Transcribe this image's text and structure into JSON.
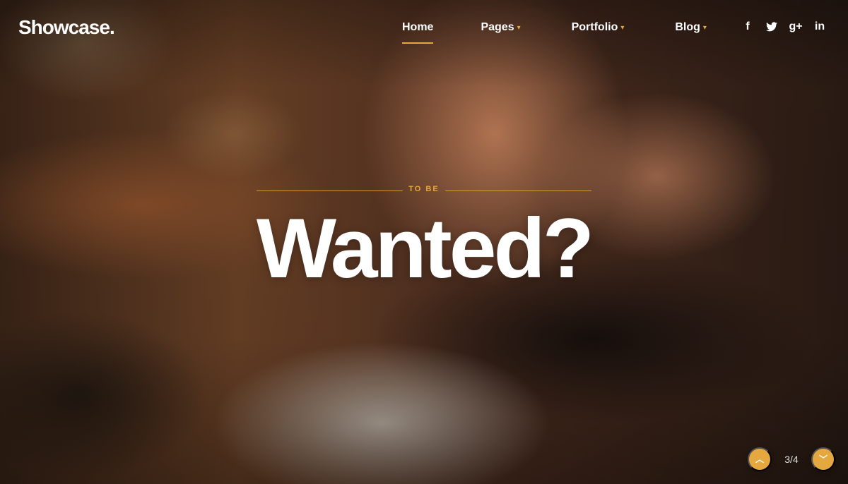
{
  "brand": {
    "name": "Showcase."
  },
  "nav": {
    "items": [
      {
        "label": "Home"
      },
      {
        "label": "Pages"
      },
      {
        "label": "Portfolio"
      },
      {
        "label": "Blog"
      }
    ]
  },
  "hero": {
    "kicker": "TO BE",
    "headline": "Wanted?"
  },
  "pager": {
    "current": "3",
    "total": "4",
    "text": "3/4"
  },
  "colors": {
    "accent": "#e5a83f",
    "white": "#ffffff"
  },
  "icons": {
    "facebook": "facebook-icon",
    "twitter": "twitter-icon",
    "googleplus": "google-plus-icon",
    "linkedin": "linkedin-icon",
    "chevron_down": "chevron-down-icon",
    "chevron_up": "chevron-up-icon"
  }
}
